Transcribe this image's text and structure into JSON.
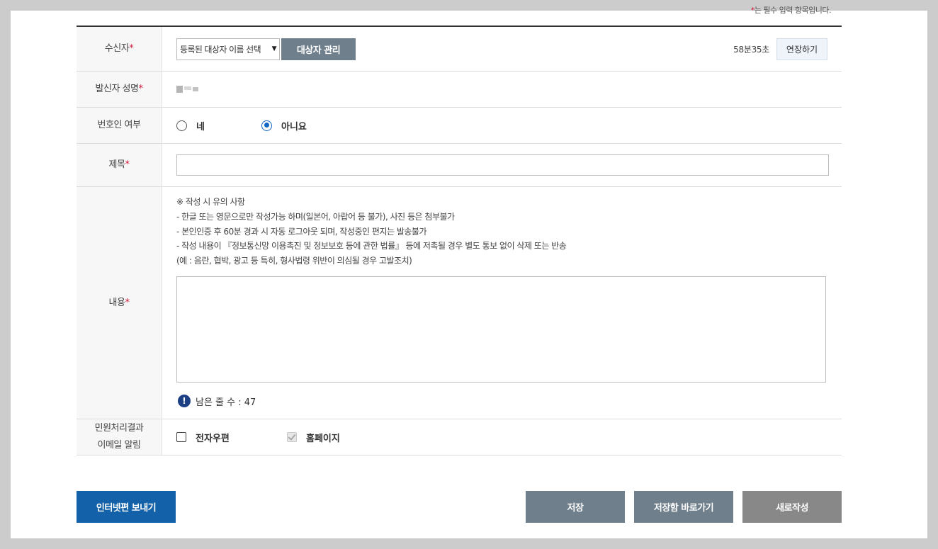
{
  "required_note": {
    "star": "*",
    "text": "는 필수 입력 항목입니다."
  },
  "recipient": {
    "label": "수신자",
    "select_value": "등록된 대상자 이름 선택",
    "manage_button": "대상자 관리",
    "timer": "58분35초",
    "extend_button": "연장하기"
  },
  "sender": {
    "label": "발신자 성명"
  },
  "lawyer": {
    "label": "번호인 여부",
    "options": [
      "네",
      "아니요"
    ],
    "selected": "아니요"
  },
  "subject": {
    "label": "제목",
    "value": ""
  },
  "content": {
    "label": "내용",
    "notice_lines": [
      "※ 작성 시 유의 사항",
      "- 한글 또는 영문으로만 작성가능 하며(일본어, 아랍어 등 불가), 사진 등은 첨부불가",
      "- 본인인증 후 60분 경과 시 자동 로그아웃 되며, 작성중인 편지는 발송불가",
      "- 작성 내용이 『정보통신망 이용촉진 및 정보보호 등에 관한 법률』 등에 저촉될 경우 별도 통보 없이 삭제 또는 반송",
      "(예 : 음란, 협박, 광고 등 특히, 형사법령 위반이 의심될 경우 고발조치)"
    ],
    "value": "",
    "remaining_label": "남은 줄 수 : 47"
  },
  "notify": {
    "label_line1": "민원처리결과",
    "label_line2": "이메일 알림",
    "options": [
      "전자우편",
      "홈페이지"
    ],
    "checked": [
      false,
      true
    ]
  },
  "buttons": {
    "send": "인터넷편 보내기",
    "save": "저장",
    "goto_saved": "저장함 바로가기",
    "new": "새로작성"
  },
  "colors": {
    "required_star": "#d0183a",
    "primary_button": "#1361a8",
    "secondary_button": "#6f7f8c",
    "new_button": "#888888",
    "radio_selected": "#1167c5"
  }
}
